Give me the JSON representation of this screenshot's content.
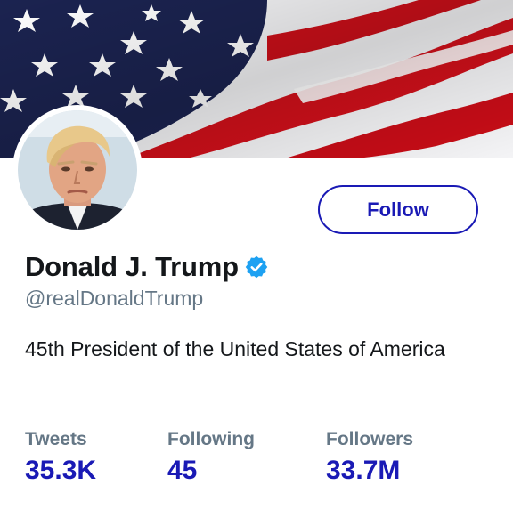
{
  "profile": {
    "name": "Donald J. Trump",
    "handle": "@realDonaldTrump",
    "bio": "45th President of the United States of America",
    "verified_icon": "verified-badge-icon",
    "banner": "american-flag"
  },
  "actions": {
    "follow_label": "Follow"
  },
  "stats": {
    "tweets": {
      "label": "Tweets",
      "value": "35.3K"
    },
    "following": {
      "label": "Following",
      "value": "45"
    },
    "followers": {
      "label": "Followers",
      "value": "33.7M"
    }
  },
  "colors": {
    "accent": "#1a1ab5",
    "verified": "#1da1f2",
    "muted_text": "#657786",
    "primary_text": "#14171a"
  }
}
